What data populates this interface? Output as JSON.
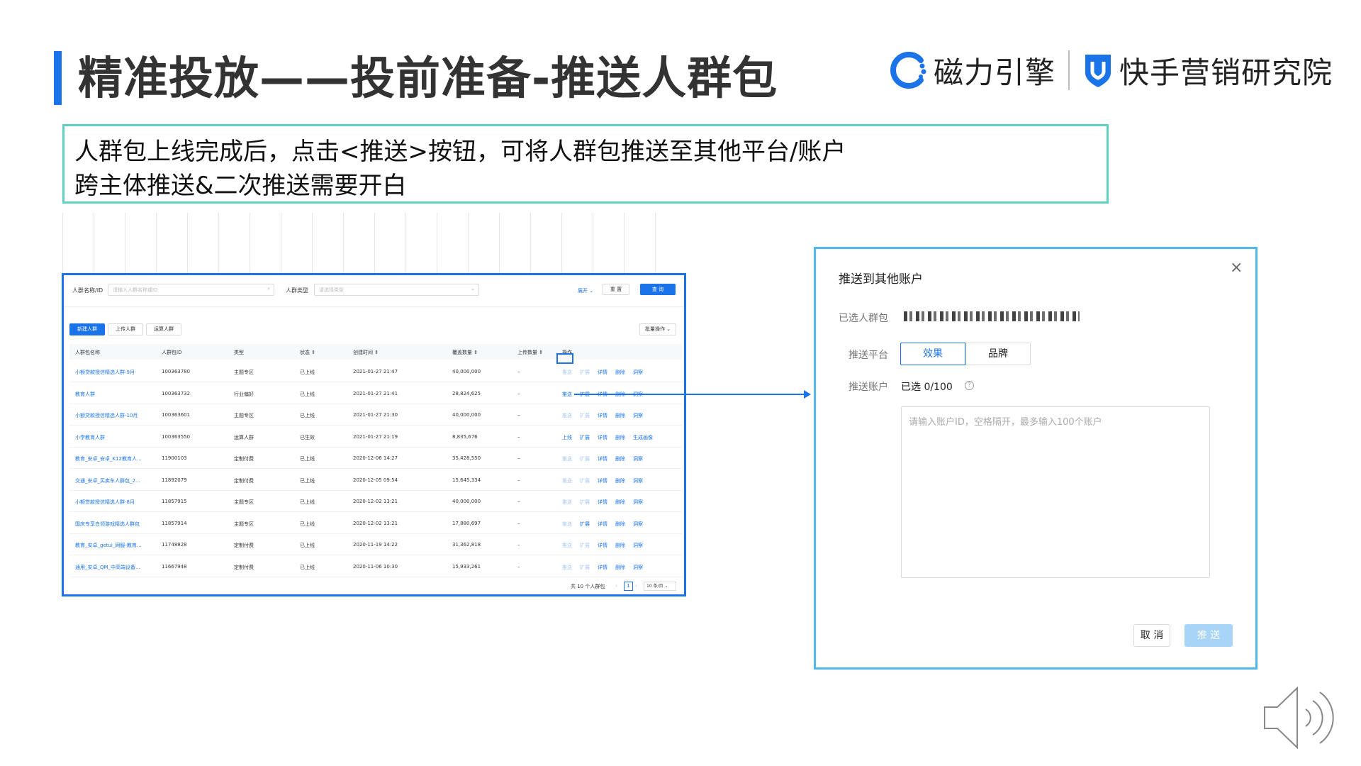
{
  "slide": {
    "title": "精准投放——投前准备-推送人群包",
    "logo_left": "磁力引擎",
    "logo_right": "快手营销研究院",
    "desc_line1": "人群包上线完成后，点击<推送>按钮，可将人群包推送至其他平台/账户",
    "desc_line2": "跨主体推送&二次推送需要开白"
  },
  "colors": {
    "accent": "#1a73e8",
    "desc_border": "#5fd0c4",
    "dialog_border": "#4fb8e8"
  },
  "filters": {
    "name_label": "人群名称/ID",
    "name_placeholder": "请输入人群名称或ID",
    "type_label": "人群类型",
    "type_placeholder": "请选择类型",
    "expand": "展开",
    "reset": "重 置",
    "query": "查 询"
  },
  "tabs": [
    "新建人群",
    "上传人群",
    "运算人群"
  ],
  "bulk_action": "批量操作",
  "columns": [
    "人群包名称",
    "人群包ID",
    "类型",
    "状态",
    "创建时间",
    "覆盖数量",
    "上传数量",
    "操作"
  ],
  "rows": [
    {
      "name": "小额贷款授信精选人群-9月",
      "id": "100363780",
      "type": "主题专区",
      "status": "已上线",
      "created": "2021-01-27 21:47",
      "count": "40,000,000",
      "upload": "–"
    },
    {
      "name": "教育人群",
      "id": "100363732",
      "type": "行业偏好",
      "status": "已上线",
      "created": "2021-01-27 21:41",
      "count": "28,824,625",
      "upload": "–"
    },
    {
      "name": "小额贷款授信精选人群-10月",
      "id": "100363601",
      "type": "主题专区",
      "status": "已上线",
      "created": "2021-01-27 21:30",
      "count": "40,000,000",
      "upload": "–"
    },
    {
      "name": "小学教育人群",
      "id": "100363550",
      "type": "运算人群",
      "status": "已生效",
      "created": "2021-01-27 21:19",
      "count": "8,835,676",
      "upload": "–"
    },
    {
      "name": "教育_安卓_安卓_K12教育人...",
      "id": "11900103",
      "type": "定制付费",
      "status": "已上线",
      "created": "2020-12-06 14:27",
      "count": "35,428,550",
      "upload": "–"
    },
    {
      "name": "交通_安卓_买卖车人群包_2...",
      "id": "11892079",
      "type": "定制付费",
      "status": "已上线",
      "created": "2020-12-05 09:54",
      "count": "15,645,334",
      "upload": "–"
    },
    {
      "name": "小额贷款授信精选人群-8月",
      "id": "11857915",
      "type": "主题专区",
      "status": "已上线",
      "created": "2020-12-02 13:21",
      "count": "40,000,000",
      "upload": "–"
    },
    {
      "name": "国庆专享白领游戏精选人群包",
      "id": "11857914",
      "type": "主题专区",
      "status": "已上线",
      "created": "2020-12-02 13:21",
      "count": "17,880,697",
      "upload": "–"
    },
    {
      "name": "教育_安卓_getui_网服-教育...",
      "id": "11748828",
      "type": "定制付费",
      "status": "已上线",
      "created": "2020-11-19 14:22",
      "count": "31,362,818",
      "upload": "–"
    },
    {
      "name": "通用_安卓_QM_中高端设备...",
      "id": "11667948",
      "type": "定制付费",
      "status": "已上线",
      "created": "2020-11-06 10:30",
      "count": "15,933,261",
      "upload": "–"
    }
  ],
  "ops": {
    "push": "推送",
    "expand": "扩展",
    "detail": "详情",
    "delete": "删除",
    "insight": "洞察",
    "online": "上线",
    "portrait": "生成画像"
  },
  "pager": {
    "total": "共 10 个人群包",
    "page": "1",
    "size": "10 条/页"
  },
  "dialog": {
    "title": "推送到其他账户",
    "close": "×",
    "selected_label": "已选人群包",
    "platform_label": "推送平台",
    "platform_options": [
      "效果",
      "品牌"
    ],
    "account_label": "推送账户",
    "selected_count": "已选  0/100",
    "help": "?",
    "textarea_placeholder": "请输入账户ID，空格隔开，最多输入100个账户",
    "cancel": "取 消",
    "push": "推 送"
  }
}
